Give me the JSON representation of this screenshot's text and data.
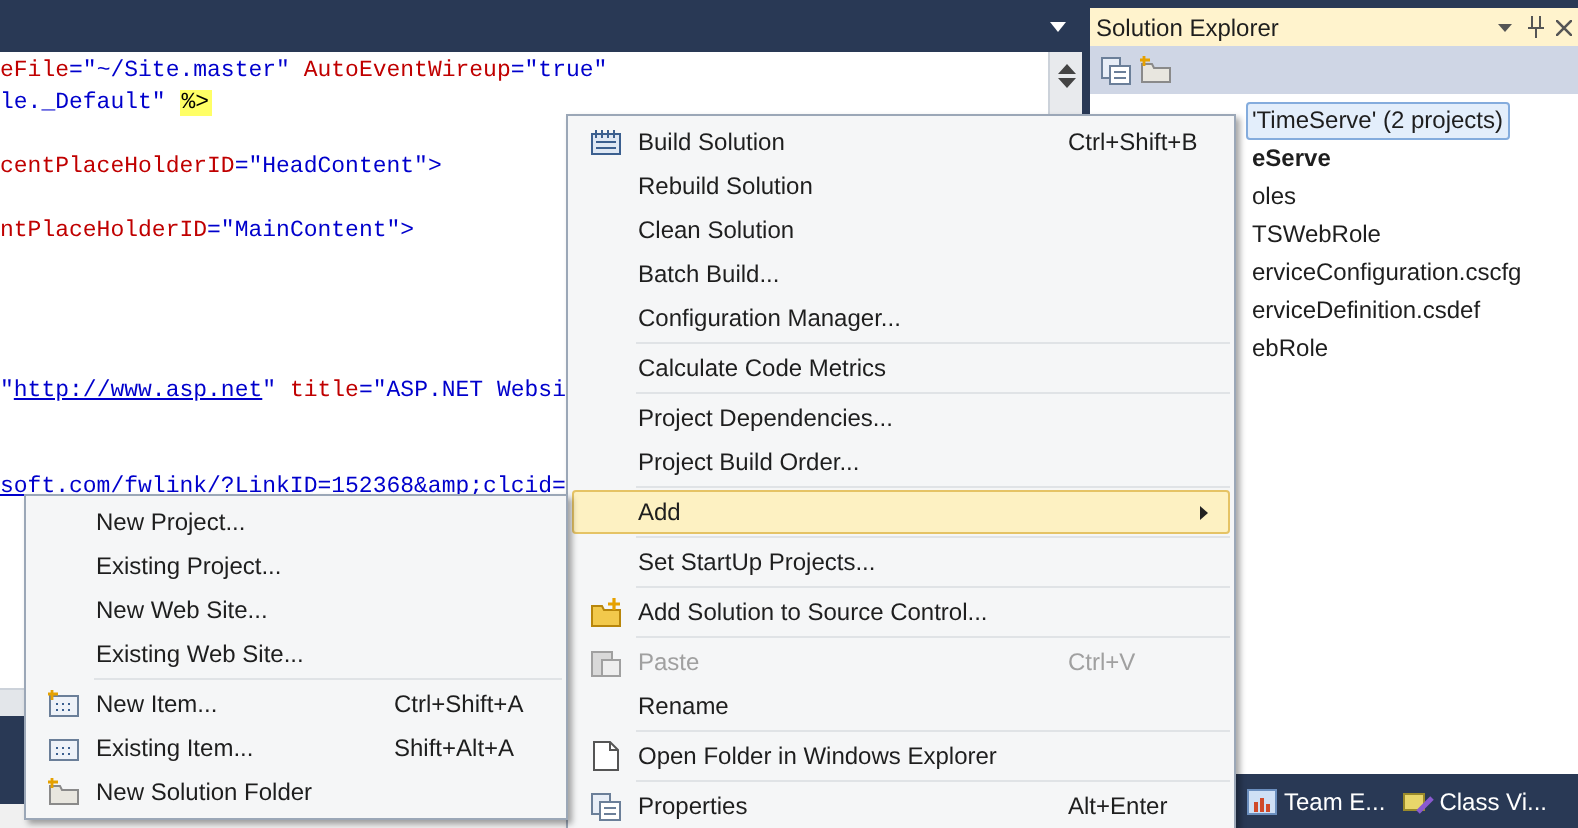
{
  "editor": {
    "code_lines": [
      [
        {
          "kind": "attr",
          "text": "eFile"
        },
        {
          "kind": "value",
          "text": "=\"~/Site.master\" "
        },
        {
          "kind": "attr",
          "text": "AutoEventWireup"
        },
        {
          "kind": "value",
          "text": "=\"true\""
        }
      ],
      [
        {
          "kind": "value",
          "text": "le._Default\" "
        },
        {
          "kind": "directive",
          "text": "%>"
        }
      ],
      {
        "kind": "blank"
      },
      [
        {
          "kind": "attr",
          "text": "centPlaceHolderID"
        },
        {
          "kind": "value",
          "text": "=\"HeadContent\">"
        }
      ],
      {
        "kind": "blank"
      },
      [
        {
          "kind": "attr",
          "text": "ntPlaceHolderID"
        },
        {
          "kind": "value",
          "text": "=\"MainContent\">"
        }
      ],
      {
        "kind": "blank"
      },
      {
        "kind": "blank"
      },
      {
        "kind": "blank"
      },
      {
        "kind": "blank"
      },
      [
        {
          "kind": "value",
          "text": "\""
        },
        {
          "kind": "link",
          "text": "http://www.asp.net"
        },
        {
          "kind": "value",
          "text": "\" "
        },
        {
          "kind": "attr",
          "text": "title"
        },
        {
          "kind": "value",
          "text": "=\"ASP.NET Websi"
        }
      ],
      {
        "kind": "blank"
      },
      {
        "kind": "blank"
      },
      [
        {
          "kind": "link",
          "text": "soft.com/fwlink/?LinkID=152368&amp;clcid="
        }
      ]
    ]
  },
  "solution_explorer": {
    "title": "Solution Explorer",
    "tree": [
      {
        "label": "'TimeServe' (2 projects)",
        "selected": true,
        "bold": false,
        "children": [
          {
            "label": "eServe",
            "selected": false,
            "bold": true,
            "children": [
              {
                "label": "oles",
                "selected": false,
                "bold": false,
                "children": [
                  {
                    "label": "TSWebRole",
                    "selected": false,
                    "bold": false
                  }
                ]
              },
              {
                "label": "erviceConfiguration.cscfg",
                "selected": false,
                "bold": false
              },
              {
                "label": "erviceDefinition.csdef",
                "selected": false,
                "bold": false
              }
            ]
          },
          {
            "label": "ebRole",
            "selected": false,
            "bold": false
          }
        ]
      }
    ],
    "tabs": [
      {
        "label": "Team E..."
      },
      {
        "label": "Class Vi..."
      }
    ]
  },
  "context_menu": {
    "items": [
      {
        "kind": "command",
        "label": "Build Solution",
        "shortcut": "Ctrl+Shift+B",
        "selected": false,
        "disabled": false,
        "submenu": false
      },
      {
        "kind": "command",
        "label": "Rebuild Solution",
        "selected": false,
        "disabled": false,
        "submenu": false
      },
      {
        "kind": "command",
        "label": "Clean Solution",
        "selected": false,
        "disabled": false,
        "submenu": false
      },
      {
        "kind": "command",
        "label": "Batch Build...",
        "selected": false,
        "disabled": false,
        "submenu": false
      },
      {
        "kind": "command",
        "label": "Configuration Manager...",
        "selected": false,
        "disabled": false,
        "submenu": false
      },
      {
        "kind": "separator"
      },
      {
        "kind": "command",
        "label": "Calculate Code Metrics",
        "selected": false,
        "disabled": false,
        "submenu": false
      },
      {
        "kind": "separator"
      },
      {
        "kind": "command",
        "label": "Project Dependencies...",
        "selected": false,
        "disabled": false,
        "submenu": false
      },
      {
        "kind": "command",
        "label": "Project Build Order...",
        "selected": false,
        "disabled": false,
        "submenu": false
      },
      {
        "kind": "separator"
      },
      {
        "kind": "command",
        "label": "Add",
        "selected": true,
        "disabled": false,
        "submenu": true
      },
      {
        "kind": "separator"
      },
      {
        "kind": "command",
        "label": "Set StartUp Projects...",
        "selected": false,
        "disabled": false,
        "submenu": false
      },
      {
        "kind": "separator"
      },
      {
        "kind": "command",
        "label": "Add Solution to Source Control...",
        "selected": false,
        "disabled": false,
        "submenu": false
      },
      {
        "kind": "separator"
      },
      {
        "kind": "command",
        "label": "Paste",
        "shortcut": "Ctrl+V",
        "selected": false,
        "disabled": true,
        "submenu": false
      },
      {
        "kind": "command",
        "label": "Rename",
        "selected": false,
        "disabled": false,
        "submenu": false
      },
      {
        "kind": "separator"
      },
      {
        "kind": "command",
        "label": "Open Folder in Windows Explorer",
        "selected": false,
        "disabled": false,
        "submenu": false
      },
      {
        "kind": "separator"
      },
      {
        "kind": "command",
        "label": "Properties",
        "shortcut": "Alt+Enter",
        "selected": false,
        "disabled": false,
        "submenu": false
      }
    ]
  },
  "add_submenu": {
    "items": [
      {
        "kind": "command",
        "label": "New Project...",
        "selected": false,
        "disabled": false
      },
      {
        "kind": "command",
        "label": "Existing Project...",
        "selected": false,
        "disabled": false
      },
      {
        "kind": "command",
        "label": "New Web Site...",
        "selected": false,
        "disabled": false
      },
      {
        "kind": "command",
        "label": "Existing Web Site...",
        "selected": false,
        "disabled": false
      },
      {
        "kind": "separator"
      },
      {
        "kind": "command",
        "label": "New Item...",
        "shortcut": "Ctrl+Shift+A",
        "selected": false,
        "disabled": false
      },
      {
        "kind": "command",
        "label": "Existing Item...",
        "shortcut": "Shift+Alt+A",
        "selected": false,
        "disabled": false
      },
      {
        "kind": "command",
        "label": "New Solution Folder",
        "selected": false,
        "disabled": false
      }
    ]
  }
}
